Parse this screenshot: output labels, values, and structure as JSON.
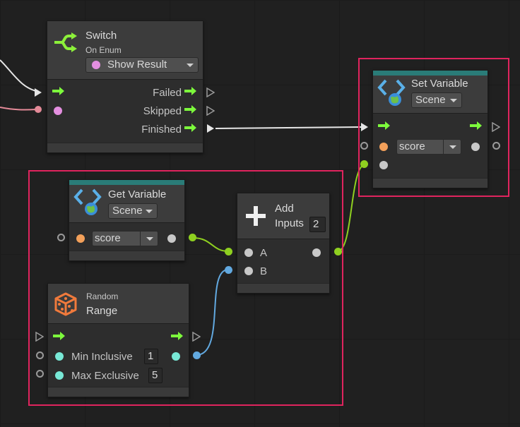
{
  "colors": {
    "selection": "#e0245e",
    "flow": "#7dfa3c",
    "enum_port": "#e48fe0",
    "string_port": "#f3a05a",
    "float_port": "#78e8d6",
    "object_port": "#c8c8c8",
    "int_wire": "#62a9e0",
    "object_wire": "#8fd020",
    "node_header_teal": "#2a7c78"
  },
  "switch_node": {
    "title": "Switch",
    "subtitle": "On Enum",
    "enum_value": "Show Result",
    "outputs": [
      "Failed",
      "Skipped",
      "Finished"
    ],
    "icon": "branch-icon"
  },
  "set_variable_node": {
    "title": "Set Variable",
    "scope": "Scene",
    "name_value": "score",
    "icon": "variable-icon"
  },
  "get_variable_node": {
    "title": "Get Variable",
    "scope": "Scene",
    "name_value": "score",
    "icon": "variable-icon"
  },
  "add_node": {
    "title": "Add",
    "inputs_label": "Inputs",
    "inputs_count": "2",
    "port_a": "A",
    "port_b": "B",
    "icon": "plus-icon"
  },
  "random_node": {
    "subtitle": "Random",
    "title": "Range",
    "min_label": "Min Inclusive",
    "min_value": "1",
    "max_label": "Max Exclusive",
    "max_value": "5",
    "icon": "dice-icon"
  }
}
